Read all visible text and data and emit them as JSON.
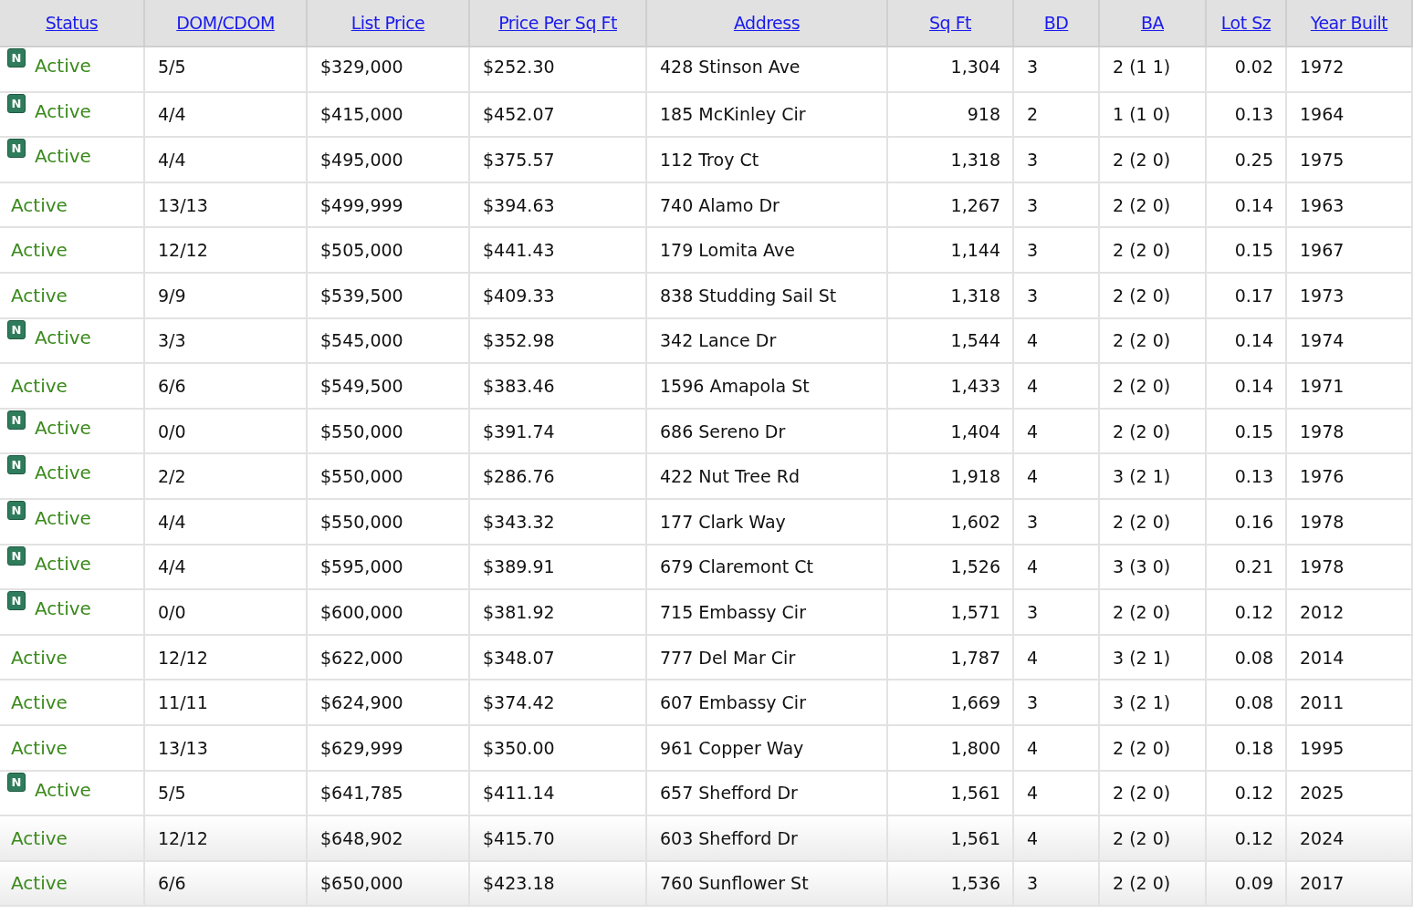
{
  "table": {
    "columns": [
      "Status",
      "DOM/CDOM",
      "List Price",
      "Price Per Sq Ft",
      "Address",
      "Sq Ft",
      "BD",
      "BA",
      "Lot Sz",
      "Year Built"
    ],
    "rows": [
      {
        "new_badge": "N",
        "status": "Active",
        "dom": "5/5",
        "price": "$329,000",
        "ppsf": "$252.30",
        "address": "428 Stinson Ave",
        "sqft": "1,304",
        "bd": "3",
        "ba": "2 (1 1)",
        "lot": "0.02",
        "year": "1972"
      },
      {
        "new_badge": "N",
        "status": "Active",
        "dom": "4/4",
        "price": "$415,000",
        "ppsf": "$452.07",
        "address": "185 McKinley Cir",
        "sqft": "918",
        "bd": "2",
        "ba": "1 (1 0)",
        "lot": "0.13",
        "year": "1964"
      },
      {
        "new_badge": "N",
        "status": "Active",
        "dom": "4/4",
        "price": "$495,000",
        "ppsf": "$375.57",
        "address": "112 Troy Ct",
        "sqft": "1,318",
        "bd": "3",
        "ba": "2 (2 0)",
        "lot": "0.25",
        "year": "1975"
      },
      {
        "status": "Active",
        "dom": "13/13",
        "price": "$499,999",
        "ppsf": "$394.63",
        "address": "740 Alamo Dr",
        "sqft": "1,267",
        "bd": "3",
        "ba": "2 (2 0)",
        "lot": "0.14",
        "year": "1963"
      },
      {
        "status": "Active",
        "dom": "12/12",
        "price": "$505,000",
        "ppsf": "$441.43",
        "address": "179 Lomita Ave",
        "sqft": "1,144",
        "bd": "3",
        "ba": "2 (2 0)",
        "lot": "0.15",
        "year": "1967"
      },
      {
        "status": "Active",
        "dom": "9/9",
        "price": "$539,500",
        "ppsf": "$409.33",
        "address": "838 Studding Sail St",
        "sqft": "1,318",
        "bd": "3",
        "ba": "2 (2 0)",
        "lot": "0.17",
        "year": "1973"
      },
      {
        "new_badge": "N",
        "status": "Active",
        "dom": "3/3",
        "price": "$545,000",
        "ppsf": "$352.98",
        "address": "342 Lance Dr",
        "sqft": "1,544",
        "bd": "4",
        "ba": "2 (2 0)",
        "lot": "0.14",
        "year": "1974"
      },
      {
        "status": "Active",
        "dom": "6/6",
        "price": "$549,500",
        "ppsf": "$383.46",
        "address": "1596 Amapola St",
        "sqft": "1,433",
        "bd": "4",
        "ba": "2 (2 0)",
        "lot": "0.14",
        "year": "1971"
      },
      {
        "new_badge": "N",
        "status": "Active",
        "dom": "0/0",
        "price": "$550,000",
        "ppsf": "$391.74",
        "address": "686 Sereno Dr",
        "sqft": "1,404",
        "bd": "4",
        "ba": "2 (2 0)",
        "lot": "0.15",
        "year": "1978"
      },
      {
        "new_badge": "N",
        "status": "Active",
        "dom": "2/2",
        "price": "$550,000",
        "ppsf": "$286.76",
        "address": "422 Nut Tree Rd",
        "sqft": "1,918",
        "bd": "4",
        "ba": "3 (2 1)",
        "lot": "0.13",
        "year": "1976"
      },
      {
        "new_badge": "N",
        "status": "Active",
        "dom": "4/4",
        "price": "$550,000",
        "ppsf": "$343.32",
        "address": "177 Clark Way",
        "sqft": "1,602",
        "bd": "3",
        "ba": "2 (2 0)",
        "lot": "0.16",
        "year": "1978"
      },
      {
        "new_badge": "N",
        "status": "Active",
        "dom": "4/4",
        "price": "$595,000",
        "ppsf": "$389.91",
        "address": "679 Claremont Ct",
        "sqft": "1,526",
        "bd": "4",
        "ba": "3 (3 0)",
        "lot": "0.21",
        "year": "1978"
      },
      {
        "new_badge": "N",
        "status": "Active",
        "dom": "0/0",
        "price": "$600,000",
        "ppsf": "$381.92",
        "address": "715 Embassy Cir",
        "sqft": "1,571",
        "bd": "3",
        "ba": "2 (2 0)",
        "lot": "0.12",
        "year": "2012"
      },
      {
        "status": "Active",
        "dom": "12/12",
        "price": "$622,000",
        "ppsf": "$348.07",
        "address": "777 Del Mar Cir",
        "sqft": "1,787",
        "bd": "4",
        "ba": "3 (2 1)",
        "lot": "0.08",
        "year": "2014"
      },
      {
        "status": "Active",
        "dom": "11/11",
        "price": "$624,900",
        "ppsf": "$374.42",
        "address": "607 Embassy Cir",
        "sqft": "1,669",
        "bd": "3",
        "ba": "3 (2 1)",
        "lot": "0.08",
        "year": "2011"
      },
      {
        "status": "Active",
        "dom": "13/13",
        "price": "$629,999",
        "ppsf": "$350.00",
        "address": "961 Copper Way",
        "sqft": "1,800",
        "bd": "4",
        "ba": "2 (2 0)",
        "lot": "0.18",
        "year": "1995"
      },
      {
        "new_badge": "N",
        "status": "Active",
        "dom": "5/5",
        "price": "$641,785",
        "ppsf": "$411.14",
        "address": "657 Shefford Dr",
        "sqft": "1,561",
        "bd": "4",
        "ba": "2 (2 0)",
        "lot": "0.12",
        "year": "2025"
      },
      {
        "status": "Active",
        "dom": "12/12",
        "price": "$648,902",
        "ppsf": "$415.70",
        "address": "603 Shefford Dr",
        "sqft": "1,561",
        "bd": "4",
        "ba": "2 (2 0)",
        "lot": "0.12",
        "year": "2024"
      },
      {
        "status": "Active",
        "dom": "6/6",
        "price": "$650,000",
        "ppsf": "$423.18",
        "address": "760 Sunflower St",
        "sqft": "1,536",
        "bd": "3",
        "ba": "2 (2 0)",
        "lot": "0.09",
        "year": "2017"
      }
    ]
  }
}
